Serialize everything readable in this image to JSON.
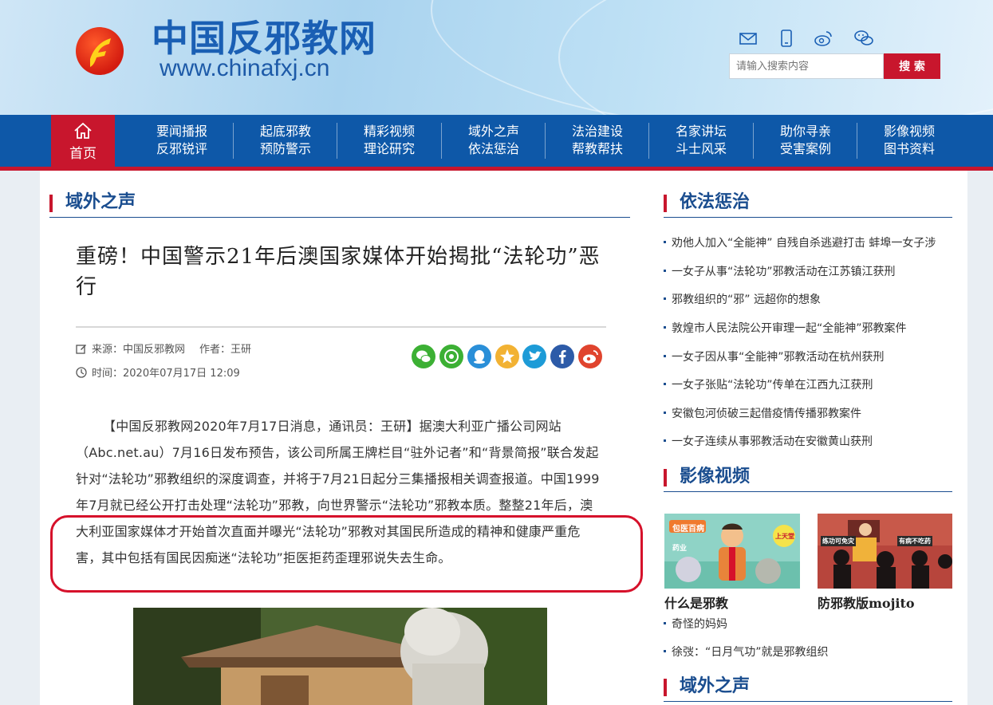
{
  "header": {
    "site_title": "中国反邪教网",
    "site_url": "www.chinafxj.cn",
    "icons": [
      "mail-icon",
      "mobile-icon",
      "weibo-icon",
      "wechat-icon"
    ],
    "search": {
      "placeholder": "请输入搜索内容",
      "button_label": "搜 索"
    }
  },
  "nav": {
    "home_label": "首页",
    "items": [
      {
        "line1": "要闻播报",
        "line2": "反邪锐评"
      },
      {
        "line1": "起底邪教",
        "line2": "预防警示"
      },
      {
        "line1": "精彩视频",
        "line2": "理论研究"
      },
      {
        "line1": "域外之声",
        "line2": "依法惩治"
      },
      {
        "line1": "法治建设",
        "line2": "帮教帮扶"
      },
      {
        "line1": "名家讲坛",
        "line2": "斗士风采"
      },
      {
        "line1": "助你寻亲",
        "line2": "受害案例"
      },
      {
        "line1": "影像视频",
        "line2": "图书资料"
      }
    ],
    "colors": {
      "nav_bg": "#0e58a8",
      "accent_red": "#c8162d"
    }
  },
  "main": {
    "section_title": "域外之声",
    "article": {
      "title": "重磅！中国警示21年后澳国家媒体开始揭批“法轮功”恶行",
      "source_label": "来源：中国反邪教网",
      "author_label": "作者：王研",
      "time_label": "时间：2020年07月17日 12:09",
      "share_icons": [
        "wechat-share-icon",
        "moments-share-icon",
        "qq-share-icon",
        "qzone-share-icon",
        "twitter-share-icon",
        "facebook-share-icon",
        "weibo-share-icon"
      ],
      "body": "【中国反邪教网2020年7月17日消息，通讯员：王研】据澳大利亚广播公司网站（Abc.net.au）7月16日发布预告，该公司所属王牌栏目“驻外记者”和“背景简报”联合发起针对“法轮功”邪教组织的深度调查，并将于7月21日起分三集播报相关调查报道。中国1999年7月就已经公开打击处理“法轮功”邪教，向世界警示“法轮功”邪教本质。整整21年后，澳大利亚国家媒体才开始首次直面并曝光“法轮功”邪教对其国民所造成的精神和健康严重危害，其中包括有国民因痴迷“法轮功”拒医拒药歪理邪说失去生命。"
    }
  },
  "sidebar": {
    "section1": {
      "title": "依法惩治",
      "items": [
        "劝他人加入“全能神” 自残自杀逃避打击 蚌埠一女子涉",
        "一女子从事“法轮功”邪教活动在江苏镇江获刑",
        "邪教组织的“邪” 远超你的想象",
        "敦煌市人民法院公开审理一起“全能神”邪教案件",
        "一女子因从事“全能神”邪教活动在杭州获刑",
        "一女子张贴“法轮功”传单在江西九江获刑",
        "安徽包河侦破三起借疫情传播邪教案件",
        "一女子连续从事邪教活动在安徽黄山获刑"
      ]
    },
    "section2": {
      "title": "影像视频",
      "videos": [
        {
          "caption": "什么是邪教",
          "thumb_texts": [
            "包医百病",
            "上天堂",
            "药业"
          ]
        },
        {
          "caption": "防邪教版mojito",
          "thumb_texts": [
            "练功可免灾",
            "有病不吃药"
          ]
        }
      ],
      "items": [
        "奇怪的妈妈",
        "徐弢：“日月气功”就是邪教组织"
      ]
    },
    "section3": {
      "title": "域外之声"
    }
  }
}
